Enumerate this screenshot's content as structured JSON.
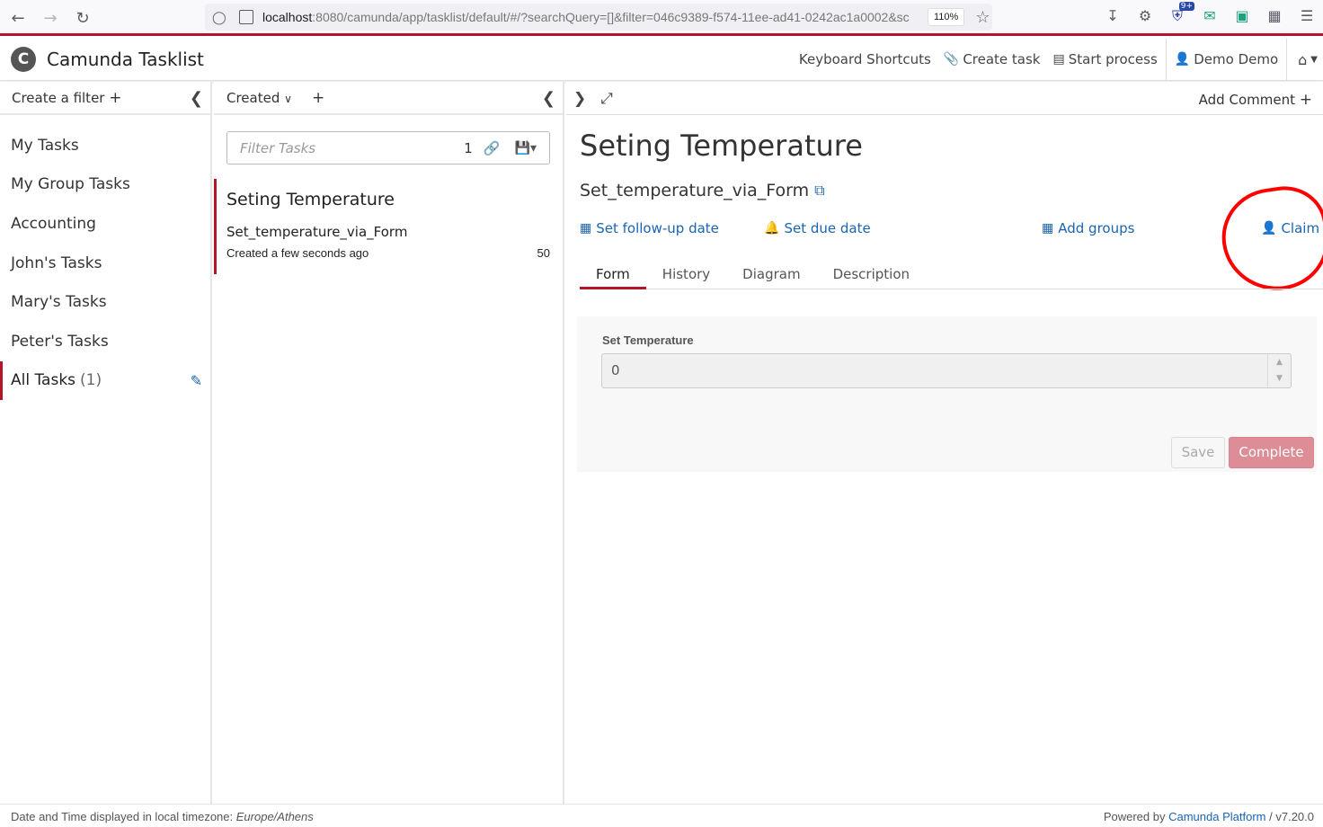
{
  "browser": {
    "url_host": "localhost",
    "url_rest": ":8080/camunda/app/tasklist/default/#/?searchQuery=[]&filter=046c9389-f574-11ee-ad41-0242ac1a0002&sc",
    "zoom": "110%",
    "ext_badge": "9+"
  },
  "header": {
    "app_title": "Camunda Tasklist",
    "logo_letter": "C",
    "keyboard_shortcuts": "Keyboard Shortcuts",
    "create_task": "Create task",
    "start_process": "Start process",
    "user": "Demo Demo"
  },
  "filters": {
    "create_filter": "Create a filter",
    "items": [
      {
        "label": "My Tasks"
      },
      {
        "label": "My Group Tasks"
      },
      {
        "label": "Accounting"
      },
      {
        "label": "John's Tasks"
      },
      {
        "label": "Mary's Tasks"
      },
      {
        "label": "Peter's Tasks"
      },
      {
        "label": "All Tasks",
        "count": "(1)"
      }
    ]
  },
  "list": {
    "sort_label": "Created",
    "search_placeholder": "Filter Tasks",
    "result_count": "1",
    "tasks": [
      {
        "name": "Seting Temperature",
        "process": "Set_temperature_via_Form",
        "created": "Created a few seconds ago",
        "priority": "50"
      }
    ]
  },
  "task": {
    "add_comment": "Add Comment",
    "title": "Seting Temperature",
    "process": "Set_temperature_via_Form",
    "actions": {
      "follow_up": "Set follow-up date",
      "due_date": "Set due date",
      "add_groups": "Add groups",
      "claim": "Claim"
    },
    "tabs": [
      "Form",
      "History",
      "Diagram",
      "Description"
    ],
    "form": {
      "field_label": "Set Temperature",
      "field_value": "0",
      "save": "Save",
      "complete": "Complete"
    }
  },
  "footer": {
    "timezone_prefix": "Date and Time displayed in local timezone:",
    "timezone": "Europe/Athens",
    "powered_by": "Powered by",
    "platform": "Camunda Platform",
    "version": "/ v7.20.0"
  },
  "colors": {
    "accent": "#b5152b",
    "link": "#1a64b4",
    "annotation": "#ff0000"
  }
}
